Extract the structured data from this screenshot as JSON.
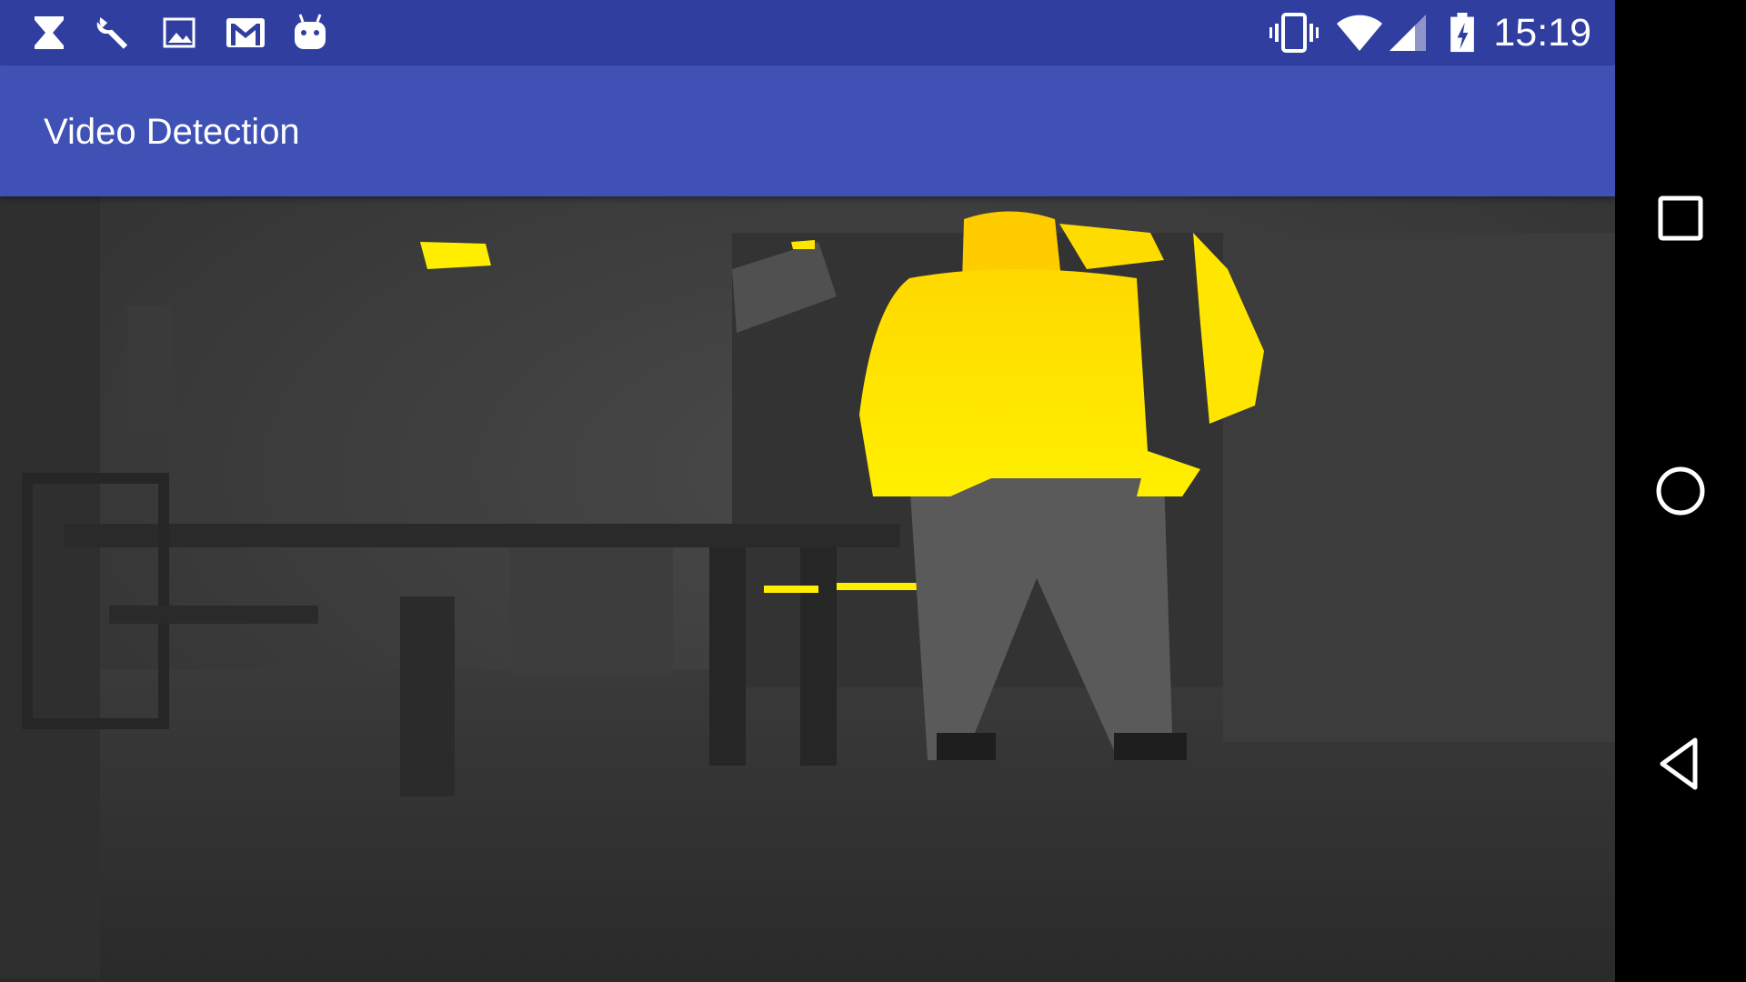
{
  "status_bar": {
    "time": "15:19",
    "left_icons": [
      "hourglass-icon",
      "wrench-icon",
      "image-icon",
      "gmail-icon",
      "android-icon"
    ],
    "right_icons": [
      "vibrate-icon",
      "wifi-icon",
      "cell-signal-icon",
      "battery-charging-icon"
    ]
  },
  "app_bar": {
    "title": "Video Detection",
    "color": "#3f51b5"
  },
  "viewer": {
    "content": "thermal-camera-feed",
    "highlight_color": "#ffee00"
  },
  "nav_bar": {
    "buttons": [
      "recents-icon",
      "home-icon",
      "back-icon"
    ]
  }
}
